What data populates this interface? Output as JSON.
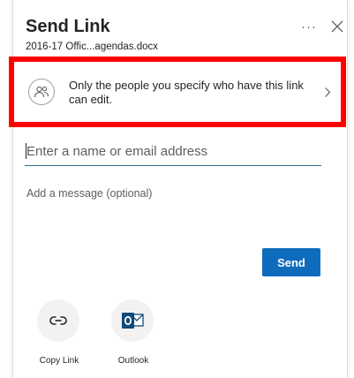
{
  "dialog": {
    "title": "Send Link",
    "filename": "2016-17 Offic...agendas.docx",
    "more_label": "···"
  },
  "permission": {
    "text": "Only the people you specify who have this link can edit."
  },
  "recipient": {
    "placeholder": "Enter a name or email address",
    "value": ""
  },
  "message": {
    "placeholder": "Add a message (optional)"
  },
  "send": {
    "label": "Send"
  },
  "share_options": [
    {
      "label": "Copy Link",
      "icon": "link-icon"
    },
    {
      "label": "Outlook",
      "icon": "outlook-icon"
    }
  ],
  "colors": {
    "accent": "#0f6cbd",
    "highlight": "#ff0000",
    "outlook": "#0f4a7a",
    "input_underline": "#2b6a8a"
  }
}
